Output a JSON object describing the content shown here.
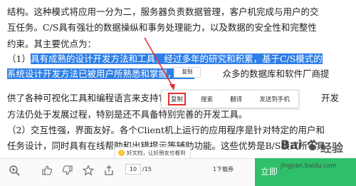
{
  "document": {
    "lines": [
      {
        "text": "结构。这种模式将应用一分为二，服务器负责数据管理，客户机完成与用户的交",
        "selected": ""
      },
      {
        "text": "互任务。C/S具有强壮的数据操纵和事务处理能力，以及数据的安全性和完整性",
        "selected": ""
      },
      {
        "text": "约束。其主要优点为：",
        "selected": ""
      },
      {
        "text": "（1）",
        "selected": "具有成熟的设计开发方法和工具，经过多年的研究和积累，基于C/S模式的"
      },
      {
        "text": "",
        "selected": "系统设计开发方法已被用户所熟悉和掌握，开发",
        "after": "众多的数据库和软件厂商提"
      },
      {
        "text": "供了各种可视化工具和编程语言来支持它的开发。",
        "selected": "",
        "after": "开发"
      },
      {
        "text": "方法仍处于发展过程，特别是还不具备特别完善的开发工具。",
        "selected": ""
      },
      {
        "text": "（2）交互性强，界面友好。各个Client机上运行的应用程序是针对特定的用户和",
        "selected": ""
      },
      {
        "text": "任务设计，同时具有在线帮助和出错提示等辅助功能。这些优势是B/S模式所不具",
        "selected": ""
      }
    ]
  },
  "tooltip": {
    "label": "复制"
  },
  "context_menu": {
    "items": [
      {
        "label": "复制",
        "active": true
      },
      {
        "label": "搜索",
        "active": false
      },
      {
        "label": "翻译",
        "active": false
      },
      {
        "label": "发送到手机",
        "active": false
      }
    ]
  },
  "toast": {
    "text": "好文档，让好朋友也看到"
  },
  "toolbar": {
    "icons": [
      "zoom-in-icon",
      "thumbs-up-icon",
      "thumbs-down-icon",
      "star-icon",
      "share-icon"
    ],
    "current_page": "10",
    "total_pages": "/15",
    "vouchers_label": "1下载券",
    "buy_label": "立即"
  },
  "watermark": {
    "brand": "Bai",
    "brand2": "经验",
    "url": "jingyan.baidu.com"
  },
  "colors": {
    "selection": "#2f7fe6",
    "arrow": "#e23030",
    "buy_button": "#2fbf6a"
  }
}
